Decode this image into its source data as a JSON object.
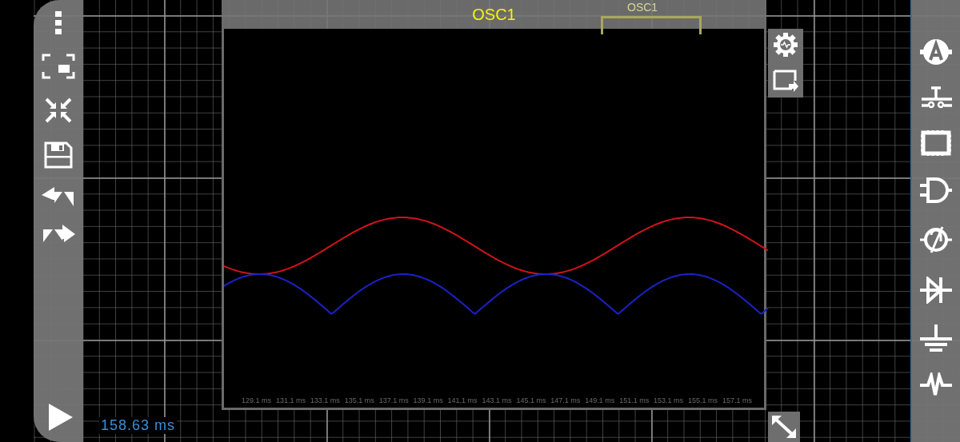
{
  "component": {
    "label": "OSC1"
  },
  "scope": {
    "title": "OSC1",
    "time_labels": [
      "129.1 ms",
      "131.1 ms",
      "133.1 ms",
      "135.1 ms",
      "137.1 ms",
      "139.1 ms",
      "141.1 ms",
      "143.1 ms",
      "145.1 ms",
      "147.1 ms",
      "149.1 ms",
      "151.1 ms",
      "153.1 ms",
      "155.1 ms",
      "157.1 ms"
    ]
  },
  "readout": "158.63 ms"
}
